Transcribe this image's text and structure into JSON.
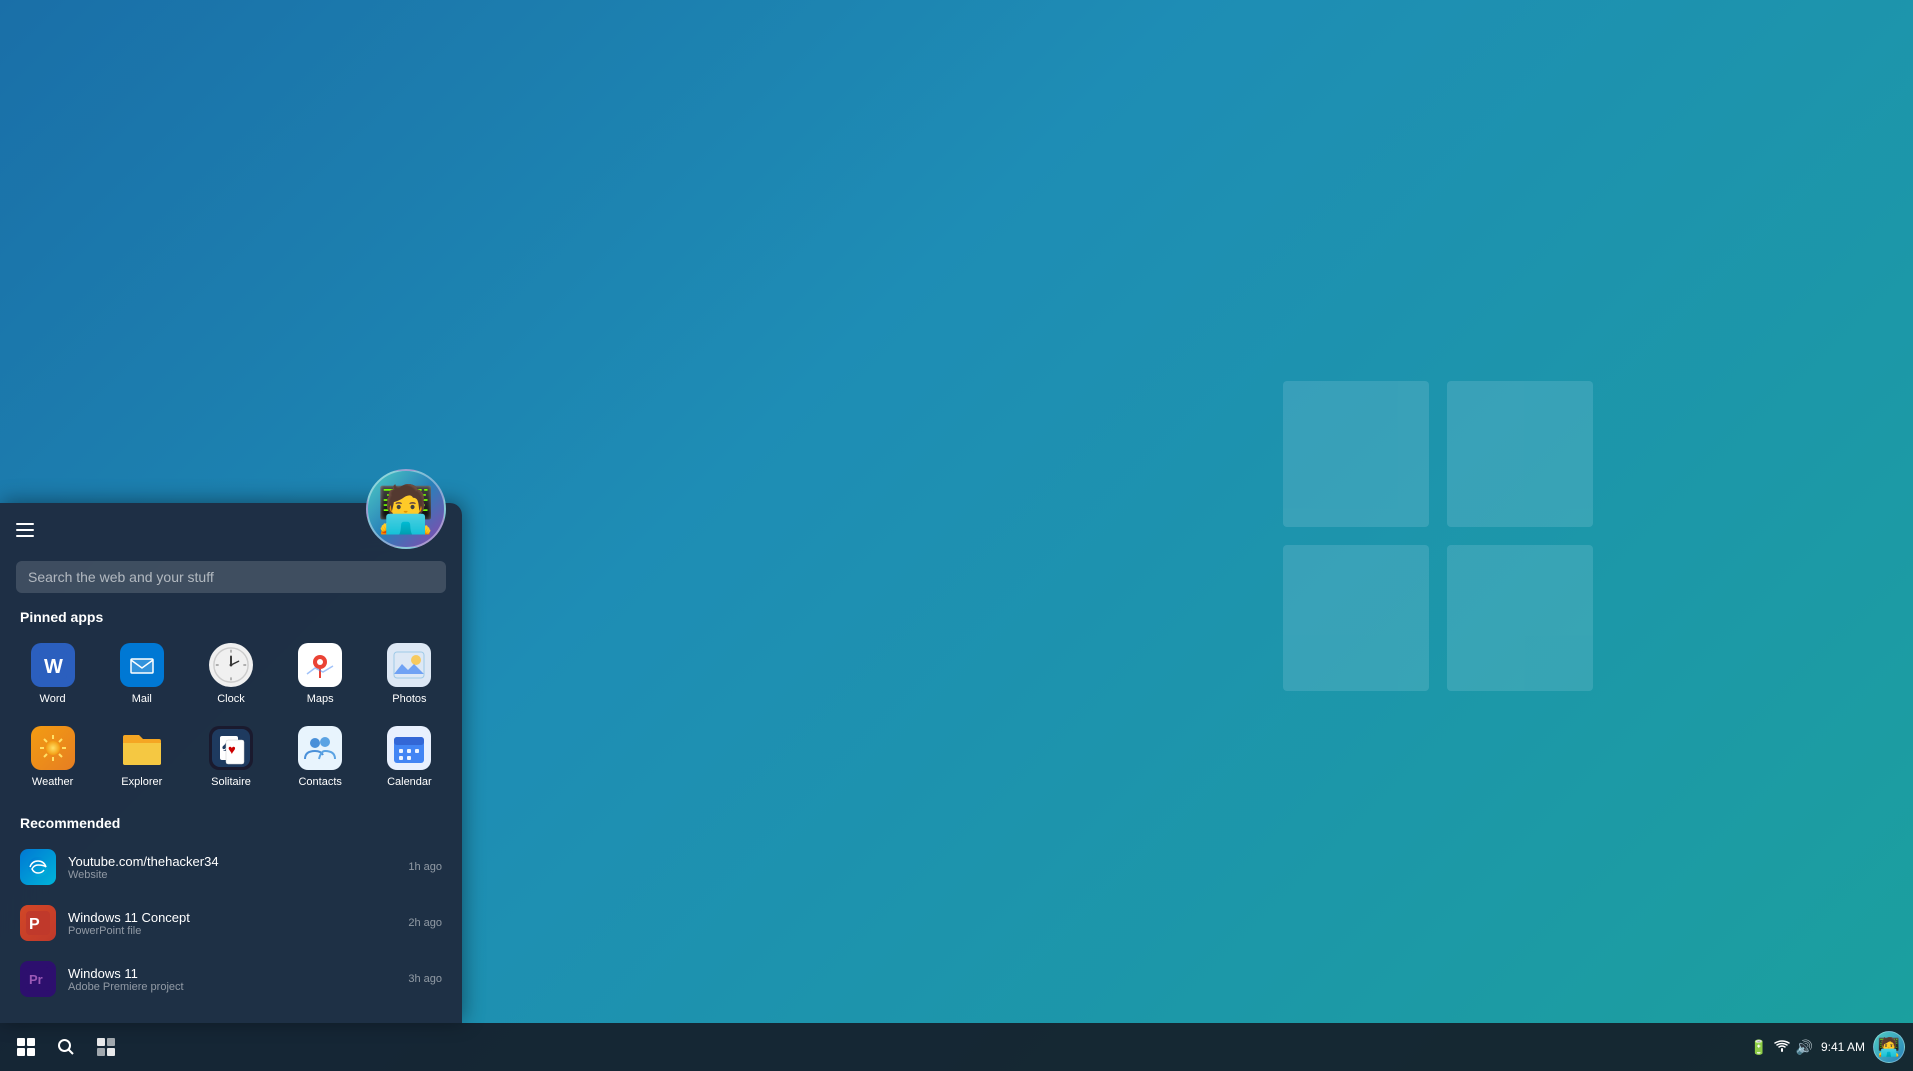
{
  "desktop": {
    "background": "linear-gradient(135deg, #1a6fa8, #1e8db5, #1ba09e)"
  },
  "taskbar": {
    "time": "9:41 AM",
    "start_label": "Start",
    "search_label": "Search",
    "widgets_label": "Widgets"
  },
  "start_menu": {
    "search_placeholder": "Search the web and your stuff",
    "pinned_title": "Pinned apps",
    "recommended_title": "Recommended",
    "apps": [
      {
        "name": "Word",
        "icon": "W",
        "color": "#2B5FBE"
      },
      {
        "name": "Mail",
        "icon": "✉",
        "color": "#0078D4"
      },
      {
        "name": "Clock",
        "icon": "clock",
        "color": "#f0f0f0"
      },
      {
        "name": "Maps",
        "icon": "📍",
        "color": "white"
      },
      {
        "name": "Photos",
        "icon": "🖼",
        "color": "#dde8f5"
      },
      {
        "name": "Weather",
        "icon": "☀",
        "color": "#f39c12"
      },
      {
        "name": "Explorer",
        "icon": "📁",
        "color": "#f39c12"
      },
      {
        "name": "Solitaire",
        "icon": "🃏",
        "color": "#1a1a2e"
      },
      {
        "name": "Contacts",
        "icon": "👥",
        "color": "#e8f4fd"
      },
      {
        "name": "Calendar",
        "icon": "📅",
        "color": "#e8f0fe"
      }
    ],
    "recommended": [
      {
        "name": "Youtube.com/thehacker34",
        "subtitle": "Website",
        "time": "1h ago",
        "icon_type": "edge"
      },
      {
        "name": "Windows 11 Concept",
        "subtitle": "PowerPoint file",
        "time": "2h ago",
        "icon_type": "ppt"
      },
      {
        "name": "Windows 11",
        "subtitle": "Adobe Premiere project",
        "time": "3h ago",
        "icon_type": "premiere"
      }
    ]
  }
}
